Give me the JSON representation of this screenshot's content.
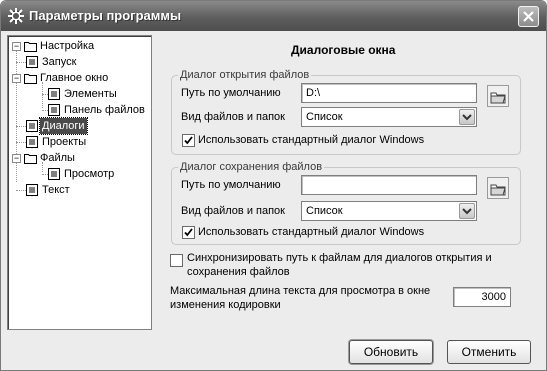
{
  "window": {
    "title": "Параметры программы"
  },
  "tree": {
    "items": [
      {
        "label": "Настройка"
      },
      {
        "label": "Запуск"
      },
      {
        "label": "Главное окно"
      },
      {
        "label": "Элементы"
      },
      {
        "label": "Панель файлов"
      },
      {
        "label": "Диалоги"
      },
      {
        "label": "Проекты"
      },
      {
        "label": "Файлы"
      },
      {
        "label": "Просмотр"
      },
      {
        "label": "Текст"
      }
    ],
    "selected": "Диалоги"
  },
  "panel": {
    "title": "Диалоговые окна",
    "open_group": {
      "legend": "Диалог открытия файлов",
      "path_label": "Путь по умолчанию",
      "path_value": "D:\\",
      "view_label": "Вид файлов и папок",
      "view_value": "Список",
      "std_dialog_label": "Использовать стандартный диалог Windows",
      "std_dialog_checked": true
    },
    "save_group": {
      "legend": "Диалог сохранения файлов",
      "path_label": "Путь по умолчанию",
      "path_value": "",
      "view_label": "Вид файлов и папок",
      "view_value": "Список",
      "std_dialog_label": "Использовать стандартный диалог Windows",
      "std_dialog_checked": true
    },
    "sync_label_line1": "Синхронизировать путь к файлам для диалогов открытия и",
    "sync_label_line2": "сохранения файлов",
    "sync_checked": false,
    "maxlen_label_line1": "Максимальная длина текста для просмотра в окне",
    "maxlen_label_line2": "изменения кодировки",
    "maxlen_value": "3000"
  },
  "buttons": {
    "ok": "Обновить",
    "cancel": "Отменить"
  },
  "icons": {
    "app": "gear-app-icon",
    "close": "close-icon",
    "expand_minus": "minus-expander-icon",
    "page": "page-icon",
    "folder": "folder-icon",
    "folder_browse": "folder-browse-icon",
    "dropdown": "chevron-down-icon",
    "check": "check-icon"
  }
}
